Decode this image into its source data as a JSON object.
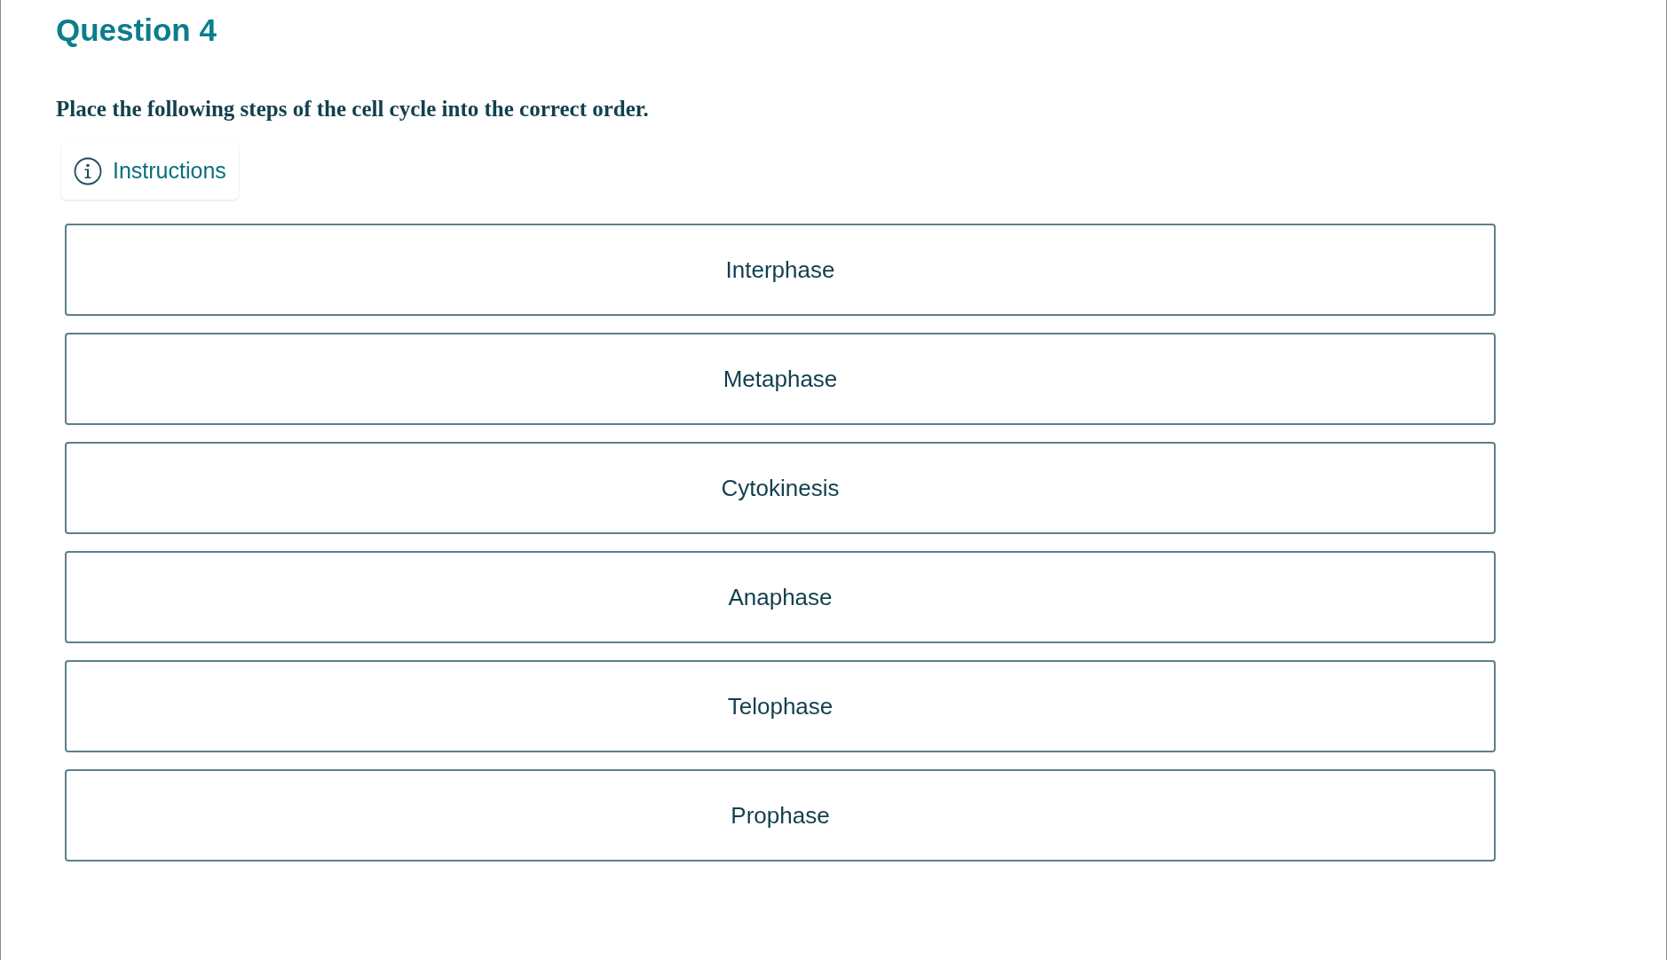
{
  "question": {
    "title": "Question 4",
    "prompt": "Place the following steps of the cell cycle into the correct order."
  },
  "instructions_button": {
    "label": "Instructions"
  },
  "items": [
    {
      "label": "Interphase"
    },
    {
      "label": "Metaphase"
    },
    {
      "label": "Cytokinesis"
    },
    {
      "label": "Anaphase"
    },
    {
      "label": "Telophase"
    },
    {
      "label": "Prophase"
    }
  ]
}
